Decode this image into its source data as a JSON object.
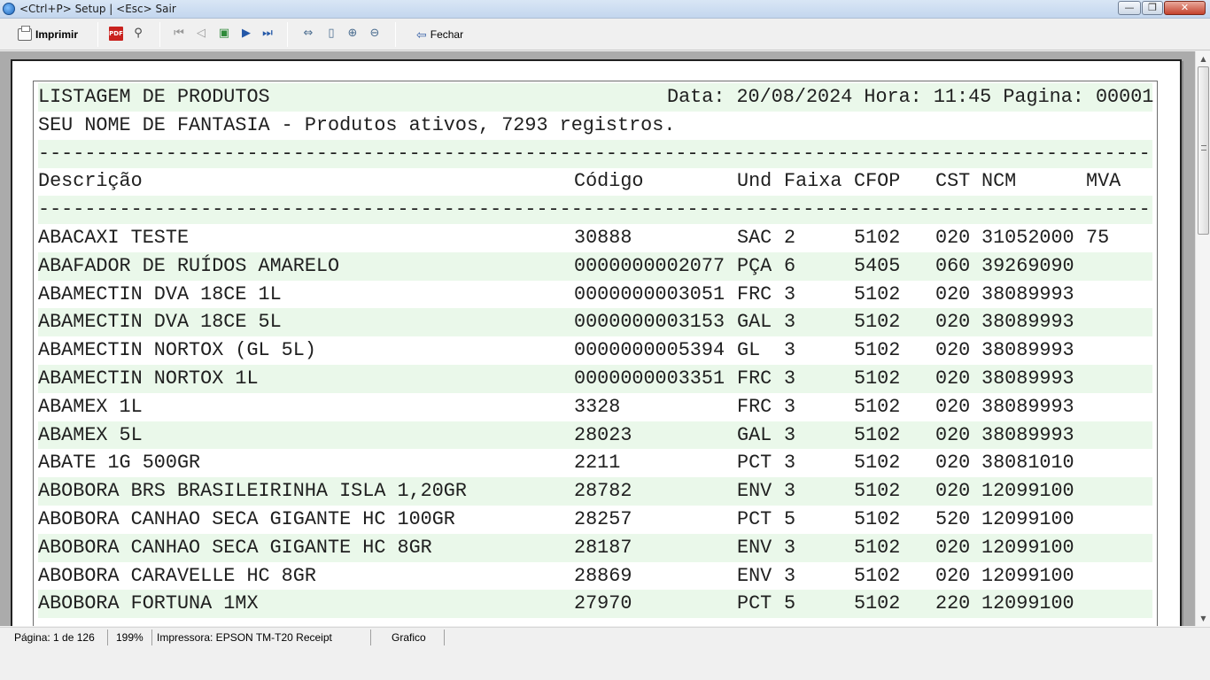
{
  "window": {
    "title": "<Ctrl+P> Setup | <Esc> Sair",
    "minimize_glyph": "—",
    "maximize_glyph": "❐",
    "close_glyph": "✕"
  },
  "toolbar": {
    "print_label": "Imprimir",
    "pdf_label": "PDF",
    "close_label": "Fechar",
    "icons": [
      "printer-icon",
      "pdf-icon",
      "binoculars-icon",
      "first-page-icon",
      "prev-page-icon",
      "goto-page-icon",
      "next-page-icon",
      "last-page-icon",
      "page-width-icon",
      "whole-page-icon",
      "zoom-in-icon",
      "zoom-out-icon",
      "exit-icon"
    ]
  },
  "report": {
    "title": "LISTAGEM DE PRODUTOS",
    "header_meta": "Data: 20/08/2024 Hora: 11:45 Pagina: 00001",
    "subtitle": "SEU NOME DE FANTASIA - Produtos ativos, 7293 registros.",
    "separator": "------------------------------------------------------------------------------------------------",
    "columns": {
      "descricao": "Descrição",
      "codigo": "Código",
      "und": "Und",
      "faixa": "Faixa",
      "cfop": "CFOP",
      "cst": "CST",
      "ncm": "NCM",
      "mva": "MVA"
    },
    "rows": [
      {
        "descricao": "ABACAXI TESTE",
        "codigo": "30888",
        "und": "SAC",
        "faixa": "2",
        "cfop": "5102",
        "cst": "020",
        "ncm": "31052000",
        "mva": "75"
      },
      {
        "descricao": "ABAFADOR DE RUÍDOS AMARELO",
        "codigo": "0000000002077",
        "und": "PÇA",
        "faixa": "6",
        "cfop": "5405",
        "cst": "060",
        "ncm": "39269090",
        "mva": ""
      },
      {
        "descricao": "ABAMECTIN DVA 18CE 1L",
        "codigo": "0000000003051",
        "und": "FRC",
        "faixa": "3",
        "cfop": "5102",
        "cst": "020",
        "ncm": "38089993",
        "mva": ""
      },
      {
        "descricao": "ABAMECTIN DVA 18CE 5L",
        "codigo": "0000000003153",
        "und": "GAL",
        "faixa": "3",
        "cfop": "5102",
        "cst": "020",
        "ncm": "38089993",
        "mva": ""
      },
      {
        "descricao": "ABAMECTIN NORTOX (GL 5L)",
        "codigo": "0000000005394",
        "und": "GL",
        "faixa": "3",
        "cfop": "5102",
        "cst": "020",
        "ncm": "38089993",
        "mva": ""
      },
      {
        "descricao": "ABAMECTIN NORTOX 1L",
        "codigo": "0000000003351",
        "und": "FRC",
        "faixa": "3",
        "cfop": "5102",
        "cst": "020",
        "ncm": "38089993",
        "mva": ""
      },
      {
        "descricao": "ABAMEX 1L",
        "codigo": "3328",
        "und": "FRC",
        "faixa": "3",
        "cfop": "5102",
        "cst": "020",
        "ncm": "38089993",
        "mva": ""
      },
      {
        "descricao": "ABAMEX 5L",
        "codigo": "28023",
        "und": "GAL",
        "faixa": "3",
        "cfop": "5102",
        "cst": "020",
        "ncm": "38089993",
        "mva": ""
      },
      {
        "descricao": "ABATE 1G 500GR",
        "codigo": "2211",
        "und": "PCT",
        "faixa": "3",
        "cfop": "5102",
        "cst": "020",
        "ncm": "38081010",
        "mva": ""
      },
      {
        "descricao": "ABOBORA BRS BRASILEIRINHA ISLA 1,20GR",
        "codigo": "28782",
        "und": "ENV",
        "faixa": "3",
        "cfop": "5102",
        "cst": "020",
        "ncm": "12099100",
        "mva": ""
      },
      {
        "descricao": "ABOBORA CANHAO SECA GIGANTE HC 100GR",
        "codigo": "28257",
        "und": "PCT",
        "faixa": "5",
        "cfop": "5102",
        "cst": "520",
        "ncm": "12099100",
        "mva": ""
      },
      {
        "descricao": "ABOBORA CANHAO SECA GIGANTE HC 8GR",
        "codigo": "28187",
        "und": "ENV",
        "faixa": "3",
        "cfop": "5102",
        "cst": "020",
        "ncm": "12099100",
        "mva": ""
      },
      {
        "descricao": "ABOBORA CARAVELLE HC 8GR",
        "codigo": "28869",
        "und": "ENV",
        "faixa": "3",
        "cfop": "5102",
        "cst": "020",
        "ncm": "12099100",
        "mva": ""
      },
      {
        "descricao": "ABOBORA FORTUNA 1MX",
        "codigo": "27970",
        "und": "PCT",
        "faixa": "5",
        "cfop": "5102",
        "cst": "220",
        "ncm": "12099100",
        "mva": ""
      }
    ]
  },
  "status": {
    "page": "Página: 1 de 126",
    "zoom": "199%",
    "printer": "Impressora: EPSON TM-T20 Receipt",
    "mode": "Grafico"
  }
}
